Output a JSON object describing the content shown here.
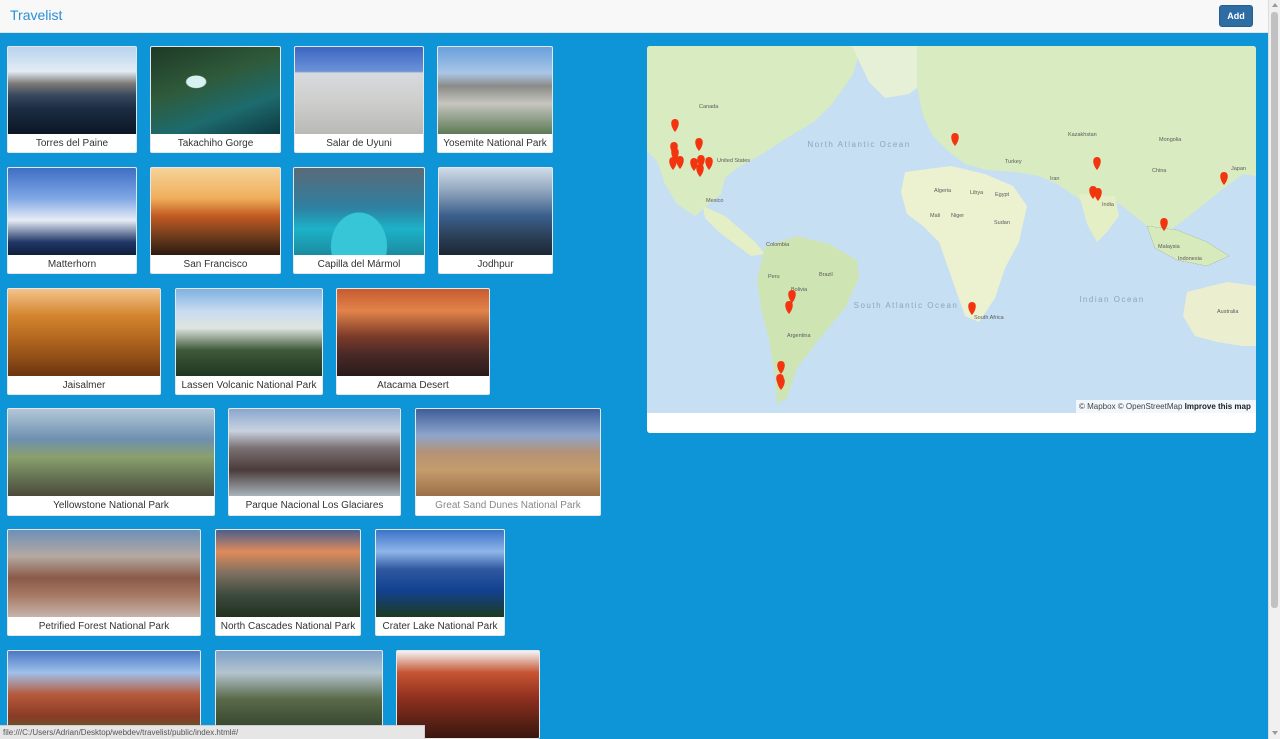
{
  "header": {
    "brand": "Travelist",
    "add_label": "Add"
  },
  "places": [
    "Torres del Paine",
    "Takachiho Gorge",
    "Salar de Uyuni",
    "Yosemite National Park",
    "Matterhorn",
    "San Francisco",
    "Capilla del Mármol",
    "Jodhpur",
    "Jaisalmer",
    "Lassen Volcanic National Park",
    "Atacama Desert",
    "Yellowstone National Park",
    "Parque Nacional Los Glaciares",
    "Great Sand Dunes National Park",
    "Petrified Forest National Park",
    "North Cascades National Park",
    "Crater Lake National Park",
    "",
    "",
    ""
  ],
  "map": {
    "labels": {
      "canada": "Canada",
      "united_states": "United States",
      "mexico": "Mexico",
      "north_atlantic": "North Atlantic Ocean",
      "south_atlantic": "South Atlantic Ocean",
      "indian": "Indian Ocean",
      "kazakhstan": "Kazakhstan",
      "mongolia": "Mongolia",
      "china": "China",
      "japan": "Japan",
      "turkey": "Turkey",
      "iran": "Iran",
      "india": "India",
      "algeria": "Algeria",
      "libya": "Libya",
      "egypt": "Egypt",
      "mali": "Mali",
      "niger": "Niger",
      "sudan": "Sudan",
      "colombia": "Colombia",
      "peru": "Peru",
      "brazil": "Brazil",
      "bolivia": "Bolivia",
      "argentina": "Argentina",
      "south_africa": "South Africa",
      "malaysia": "Malaysia",
      "indonesia": "Indonesia",
      "australia": "Australia"
    },
    "attribution": {
      "text": "© Mapbox © OpenStreetMap",
      "improve": "Improve this map"
    },
    "marker_color": "#f2340f"
  },
  "status": {
    "url": "file:///C:/Users/Adrian/Desktop/webdev/travelist/public/index.html#/"
  }
}
